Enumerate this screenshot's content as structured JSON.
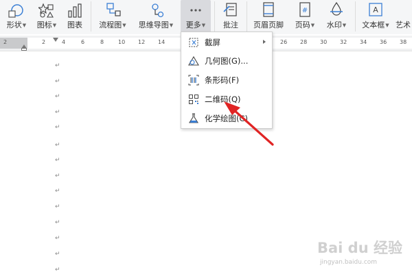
{
  "ribbon": {
    "items": [
      {
        "label": "形状",
        "icon": "shape-icon",
        "has_caret": true
      },
      {
        "label": "图标",
        "icon": "icons-gallery-icon",
        "has_caret": true
      },
      {
        "label": "图表",
        "icon": "chart-icon",
        "has_caret": false
      },
      {
        "label": "流程图",
        "icon": "flowchart-icon",
        "has_caret": true
      },
      {
        "label": "思维导图",
        "icon": "mindmap-icon",
        "has_caret": true
      },
      {
        "label": "更多",
        "icon": "more-dots-icon",
        "has_caret": true,
        "active": true
      },
      {
        "label": "批注",
        "icon": "comment-icon",
        "has_caret": false
      },
      {
        "label": "页眉页脚",
        "icon": "header-footer-icon",
        "has_caret": false
      },
      {
        "label": "页码",
        "icon": "page-number-icon",
        "has_caret": true
      },
      {
        "label": "水印",
        "icon": "watermark-icon",
        "has_caret": true
      },
      {
        "label": "文本框",
        "icon": "textbox-icon",
        "has_caret": true
      },
      {
        "label": "艺术",
        "icon": "wordart-icon",
        "has_caret": false
      }
    ]
  },
  "ruler": {
    "ticks": [
      "2",
      "2",
      "4",
      "6",
      "8",
      "10",
      "12",
      "14",
      "26",
      "28",
      "30",
      "32",
      "34",
      "36",
      "38"
    ]
  },
  "more_menu": {
    "items": [
      {
        "label": "截屏",
        "icon": "screenshot-icon",
        "submenu": true
      },
      {
        "label": "几何图(G)...",
        "icon": "geometry-icon",
        "submenu": false
      },
      {
        "label": "条形码(F)",
        "icon": "barcode-icon",
        "submenu": false
      },
      {
        "label": "二维码(Q)",
        "icon": "qr-code-icon",
        "submenu": false
      },
      {
        "label": "化学绘图(C)",
        "icon": "chemistry-flask-icon",
        "submenu": false
      }
    ]
  },
  "document": {
    "paragraph_mark": "↵"
  },
  "watermark": {
    "brand": "Bai du 经验",
    "url": "jingyan.baidu.com"
  },
  "colors": {
    "annotation_arrow": "#e02424",
    "ribbon_bg": "#f5f6f7",
    "active_item_bg": "#d9dade",
    "icon_blue": "#3a7fd5"
  }
}
